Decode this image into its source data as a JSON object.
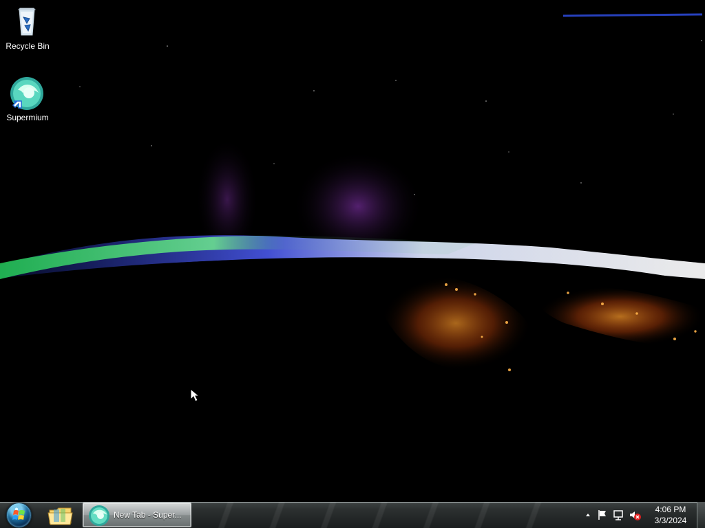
{
  "desktop": {
    "icons": [
      {
        "label": "Recycle Bin",
        "icon": "recycle-bin-icon"
      },
      {
        "label": "Supermium",
        "icon": "supermium-icon"
      }
    ],
    "wallpaper": {
      "subject": "space-earth-aurora",
      "colors": {
        "green": "#29c85a",
        "blue": "#4863ff",
        "purple": "#7d2c9c",
        "city_lights": "#ff7a17"
      }
    }
  },
  "taskbar": {
    "start_icon": "windows-start-orb-icon",
    "quicklaunch_icon": "file-explorer-icon",
    "active_window": {
      "label": "New Tab - Super...",
      "icon": "supermium-icon"
    },
    "tray": {
      "icons": [
        "show-hidden-icons-icon",
        "action-center-flag-icon",
        "network-icon",
        "volume-muted-icon"
      ],
      "time": "4:06 PM",
      "date": "3/3/2024"
    }
  }
}
